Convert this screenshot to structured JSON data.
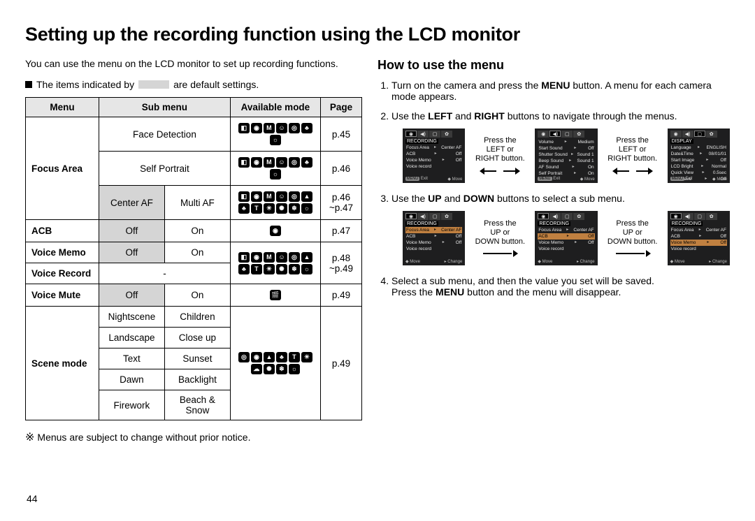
{
  "title": "Setting up the recording function using the LCD monitor",
  "left": {
    "intro": "You can use the menu on the LCD monitor to set up recording functions.",
    "bullet_pre": "The items indicated by",
    "bullet_post": "are default settings.",
    "headers": {
      "menu": "Menu",
      "sub": "Sub menu",
      "mode": "Available mode",
      "page": "Page"
    },
    "rows": {
      "focus_area": {
        "label": "Focus Area",
        "r1_sub": "Face Detection",
        "r1_page": "p.45",
        "r2_sub": "Self Portrait",
        "r2_page": "p.46",
        "r3_sub1": "Center AF",
        "r3_sub2": "Multi AF",
        "r3_page": "p.46\n~p.47"
      },
      "acb": {
        "label": "ACB",
        "off": "Off",
        "on": "On",
        "page": "p.47"
      },
      "voice_memo": {
        "label": "Voice Memo",
        "off": "Off",
        "on": "On"
      },
      "voice_record": {
        "label": "Voice Record",
        "dash": "-",
        "page": "p.48\n~p.49"
      },
      "voice_mute": {
        "label": "Voice Mute",
        "off": "Off",
        "on": "On",
        "page": "p.49"
      },
      "scene": {
        "label": "Scene mode",
        "cells": [
          [
            "Nightscene",
            "Children"
          ],
          [
            "Landscape",
            "Close up"
          ],
          [
            "Text",
            "Sunset"
          ],
          [
            "Dawn",
            "Backlight"
          ],
          [
            "Firework",
            "Beach & Snow"
          ]
        ],
        "page": "p.49"
      }
    },
    "footnote": "Menus are subject to change without prior notice."
  },
  "right": {
    "heading": "How to use the menu",
    "steps": {
      "s1a": "Turn on the camera and press the ",
      "s1b": "MENU",
      "s1c": " button. A menu for each camera mode appears.",
      "s2a": "Use the ",
      "s2b": "LEFT",
      "s2c": " and ",
      "s2d": "RIGHT",
      "s2e": " buttons to navigate through the menus.",
      "s3a": "Use the ",
      "s3b": "UP",
      "s3c": " and ",
      "s3d": "DOWN",
      "s3e": " buttons to select a sub menu.",
      "s4a": "Select a sub menu, and then the value you set will be saved.",
      "s4b": "Press the ",
      "s4c": "MENU",
      "s4d": " button and the menu will disappear."
    },
    "captions": {
      "lr": "Press the\nLEFT or\nRIGHT button.",
      "ud": "Press the\nUP or\nDOWN button."
    },
    "lcd": {
      "recording_hdr": "RECORDING",
      "display_hdr": "DISPLAY",
      "rec1": [
        [
          "Focus Area",
          "Center AF"
        ],
        [
          "ACB",
          "Off"
        ],
        [
          "Voice Memo",
          "Off"
        ],
        [
          "Voice record",
          ""
        ],
        [
          "",
          ""
        ]
      ],
      "rec2": [
        [
          "Volume",
          "Medium"
        ],
        [
          "Start Sound",
          "Off"
        ],
        [
          "Shutter Sound",
          "Sound 1"
        ],
        [
          "Beep Sound",
          "Sound 1"
        ],
        [
          "AF Sound",
          "On"
        ],
        [
          "Self Portrait",
          "On"
        ]
      ],
      "disp": [
        [
          "Language",
          "ENGLISH"
        ],
        [
          "Date&Time",
          "08/01/01"
        ],
        [
          "Start Image",
          "Off"
        ],
        [
          "LCD Bright",
          "Normal"
        ],
        [
          "Quick View",
          "0.5sec"
        ],
        [
          "LCD Save",
          "Off"
        ]
      ],
      "rec_step3a": [
        [
          "Focus Area",
          "Center AF"
        ],
        [
          "ACB",
          "Off"
        ],
        [
          "Voice Memo",
          "Off"
        ],
        [
          "Voice record",
          ""
        ]
      ],
      "rec_step3b": [
        [
          "Focus Area",
          "Center AF"
        ],
        [
          "ACB",
          "Off"
        ],
        [
          "Voice Memo",
          "Off"
        ],
        [
          "Voice record",
          ""
        ]
      ],
      "rec_step3c": [
        [
          "Focus Area",
          "Center AF"
        ],
        [
          "ACB",
          "Off"
        ],
        [
          "Voice Memo",
          "Off"
        ],
        [
          "Voice record",
          ""
        ]
      ],
      "foot_exit": "Exit",
      "foot_move": "Move",
      "foot_change": "Change",
      "menu_pill": "MENU"
    }
  },
  "page_number": "44"
}
